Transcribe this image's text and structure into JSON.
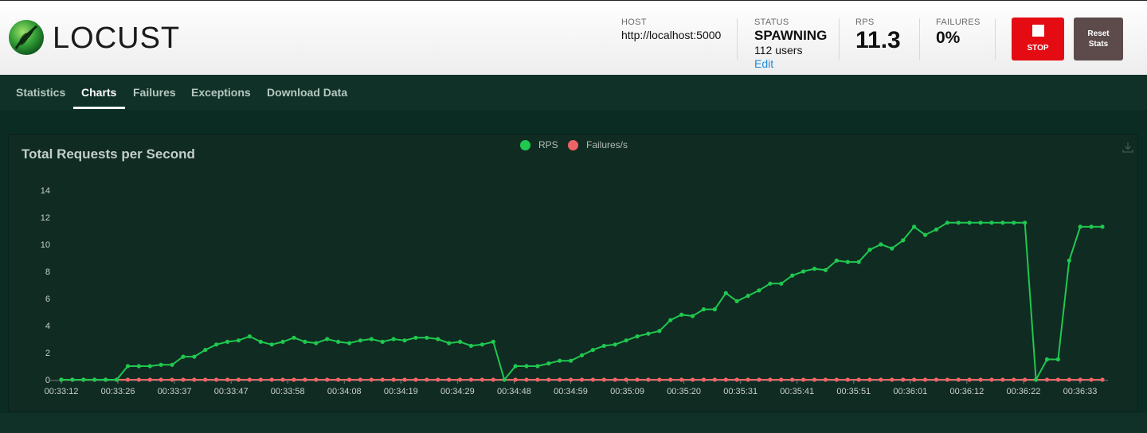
{
  "app": {
    "name": "LOCUST"
  },
  "header": {
    "host": {
      "label": "HOST",
      "value": "http://localhost:5000"
    },
    "status": {
      "label": "STATUS",
      "value": "SPAWNING",
      "users": "112 users",
      "edit": "Edit"
    },
    "rps": {
      "label": "RPS",
      "value": "11.3"
    },
    "failures": {
      "label": "FAILURES",
      "value": "0%"
    },
    "stop_label": "STOP",
    "reset_label_1": "Reset",
    "reset_label_2": "Stats"
  },
  "tabs": [
    {
      "label": "Statistics",
      "active": false
    },
    {
      "label": "Charts",
      "active": true
    },
    {
      "label": "Failures",
      "active": false
    },
    {
      "label": "Exceptions",
      "active": false
    },
    {
      "label": "Download Data",
      "active": false
    }
  ],
  "chart": {
    "title": "Total Requests per Second"
  },
  "icons": {
    "stop": "stop-square-icon",
    "download": "download-icon",
    "logo": "locust-logo-icon"
  },
  "colors": {
    "rps": "#1fc84f",
    "failures": "#ef6467",
    "stop": "#e40c12",
    "reset": "#5d4b4b"
  },
  "chart_data": {
    "type": "line",
    "title": "Total Requests per Second",
    "xlabel": "",
    "ylabel": "",
    "ylim": [
      0,
      14
    ],
    "yticks": [
      0,
      2,
      4,
      6,
      8,
      10,
      12,
      14
    ],
    "legend_position": "top-center",
    "grid": false,
    "x_tick_labels": [
      "00:33:12",
      "00:33:26",
      "00:33:37",
      "00:33:47",
      "00:33:58",
      "00:34:08",
      "00:34:19",
      "00:34:29",
      "00:34:48",
      "00:34:59",
      "00:35:09",
      "00:35:20",
      "00:35:31",
      "00:35:41",
      "00:35:51",
      "00:36:01",
      "00:36:12",
      "00:36:22",
      "00:36:33"
    ],
    "series": [
      {
        "name": "RPS",
        "values": [
          0,
          0,
          0,
          0,
          0,
          0,
          1,
          1,
          1,
          1.1,
          1.1,
          1.7,
          1.7,
          2.2,
          2.6,
          2.8,
          2.9,
          3.2,
          2.8,
          2.6,
          2.8,
          3.1,
          2.8,
          2.7,
          3.0,
          2.8,
          2.7,
          2.9,
          3.0,
          2.8,
          3.0,
          2.9,
          3.1,
          3.1,
          3.0,
          2.7,
          2.8,
          2.5,
          2.6,
          2.8,
          0,
          1,
          1,
          1,
          1.2,
          1.4,
          1.4,
          1.8,
          2.2,
          2.5,
          2.6,
          2.9,
          3.2,
          3.4,
          3.6,
          4.4,
          4.8,
          4.7,
          5.2,
          5.2,
          6.4,
          5.8,
          6.2,
          6.6,
          7.1,
          7.1,
          7.7,
          8.0,
          8.2,
          8.1,
          8.8,
          8.7,
          8.7,
          9.6,
          10,
          9.7,
          10.3,
          11.3,
          10.7,
          11.1,
          11.6,
          11.6,
          11.6,
          11.6,
          11.6,
          11.6,
          11.6,
          11.6,
          0,
          1.5,
          1.5,
          8.8,
          11.3,
          11.3,
          11.3
        ]
      },
      {
        "name": "Failures/s",
        "values": [
          0,
          0,
          0,
          0,
          0,
          0,
          0,
          0,
          0,
          0,
          0,
          0,
          0,
          0,
          0,
          0,
          0,
          0,
          0,
          0,
          0,
          0,
          0,
          0,
          0,
          0,
          0,
          0,
          0,
          0,
          0,
          0,
          0,
          0,
          0,
          0,
          0,
          0,
          0,
          0,
          0,
          0,
          0,
          0,
          0,
          0,
          0,
          0,
          0,
          0,
          0,
          0,
          0,
          0,
          0,
          0,
          0,
          0,
          0,
          0,
          0,
          0,
          0,
          0,
          0,
          0,
          0,
          0,
          0,
          0,
          0,
          0,
          0,
          0,
          0,
          0,
          0,
          0,
          0,
          0,
          0,
          0,
          0,
          0,
          0,
          0,
          0,
          0,
          0,
          0,
          0,
          0,
          0,
          0,
          0
        ]
      }
    ]
  }
}
